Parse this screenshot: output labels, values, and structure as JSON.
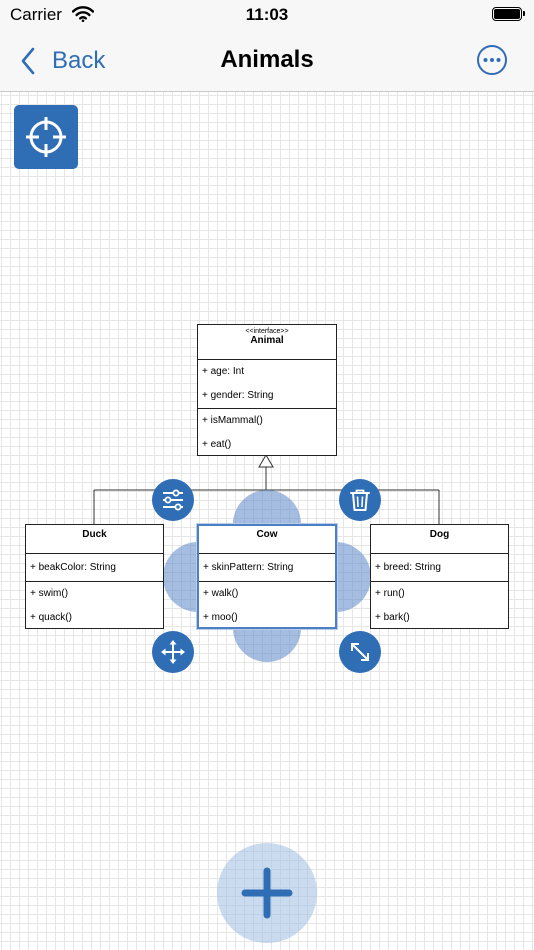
{
  "status_bar": {
    "carrier": "Carrier",
    "time": "11:03"
  },
  "nav": {
    "back_label": "Back",
    "title": "Animals"
  },
  "icons": {
    "recenter": "crosshair-icon",
    "more": "ellipsis-circle-icon",
    "settings": "sliders-icon",
    "delete": "trash-icon",
    "move": "move-arrows-icon",
    "resize": "resize-diagonal-icon",
    "add": "plus-icon"
  },
  "colors": {
    "accent": "#2f6db5",
    "selection": "#4d7fc4"
  },
  "diagram": {
    "animal": {
      "stereotype": "<<interface>>",
      "name": "Animal",
      "attributes": [
        "+ age: Int",
        "+ gender: String"
      ],
      "methods": [
        "+ isMammal()",
        "+ eat()"
      ]
    },
    "duck": {
      "name": "Duck",
      "attributes": [
        "+ beakColor: String"
      ],
      "methods": [
        "+ swim()",
        "+ quack()"
      ]
    },
    "cow": {
      "name": "Cow",
      "attributes": [
        "+ skinPattern: String"
      ],
      "methods": [
        "+ walk()",
        "+ moo()"
      ]
    },
    "dog": {
      "name": "Dog",
      "attributes": [
        "+ breed: String"
      ],
      "methods": [
        "+ run()",
        "+ bark()"
      ]
    }
  }
}
